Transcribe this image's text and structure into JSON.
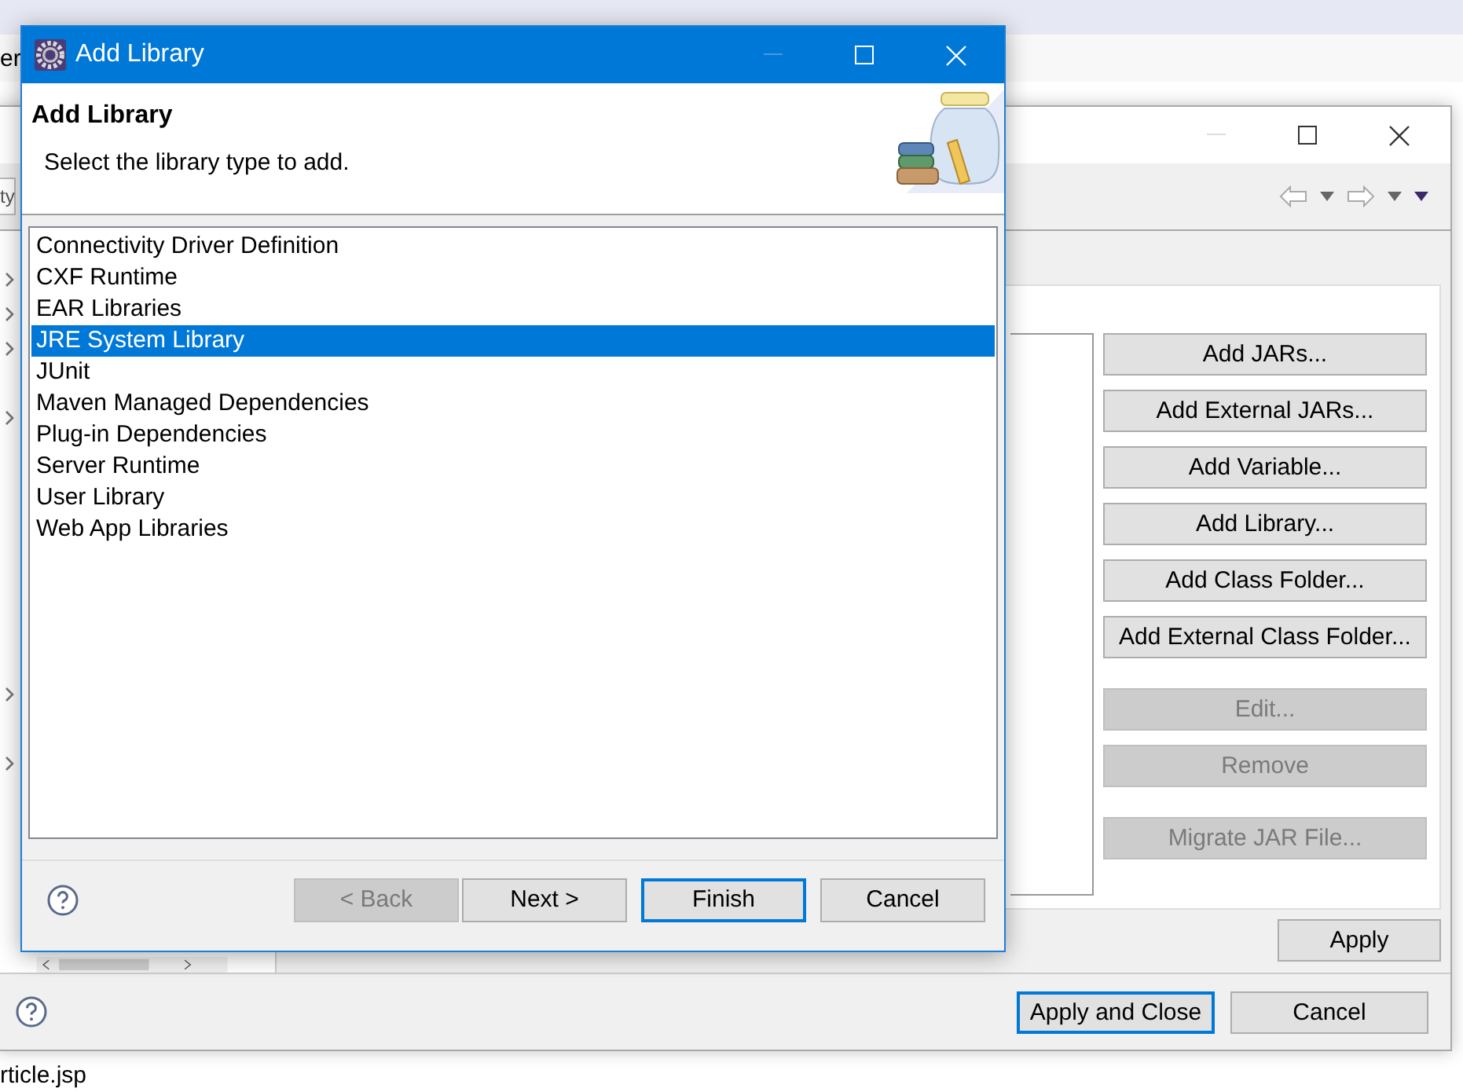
{
  "background_app": {
    "fragment_top": "er",
    "fragment_bottom": "rticle.jsp"
  },
  "back_window": {
    "filter_text": "ty",
    "tree_rows": [
      {
        "expandable": true
      },
      {
        "expandable": true
      },
      {
        "expandable": true
      },
      {
        "expandable": false
      },
      {
        "expandable": true
      },
      {
        "expandable": false
      },
      {
        "expandable": false
      },
      {
        "expandable": false
      },
      {
        "expandable": false
      },
      {
        "expandable": false
      },
      {
        "expandable": false
      },
      {
        "expandable": false
      },
      {
        "expandable": true
      },
      {
        "expandable": false
      },
      {
        "expandable": true
      }
    ],
    "button_groups": [
      [
        {
          "label": "Add JARs...",
          "disabled": false
        },
        {
          "label": "Add External JARs...",
          "disabled": false
        },
        {
          "label": "Add Variable...",
          "disabled": false
        },
        {
          "label": "Add Library...",
          "disabled": false
        },
        {
          "label": "Add Class Folder...",
          "disabled": false
        },
        {
          "label": "Add External Class Folder...",
          "disabled": false
        }
      ],
      [
        {
          "label": "Edit...",
          "disabled": true
        },
        {
          "label": "Remove",
          "disabled": true
        }
      ],
      [
        {
          "label": "Migrate JAR File...",
          "disabled": true
        }
      ]
    ],
    "apply_button": "Apply",
    "footer_buttons": [
      {
        "label": "Apply and Close",
        "default": true
      },
      {
        "label": "Cancel",
        "default": false
      }
    ]
  },
  "dialog": {
    "title": "Add Library",
    "heading": "Add Library",
    "description": "Select the library type to add.",
    "library_types": [
      {
        "label": "Connectivity Driver Definition",
        "selected": false
      },
      {
        "label": "CXF Runtime",
        "selected": false
      },
      {
        "label": "EAR Libraries",
        "selected": false
      },
      {
        "label": "JRE System Library",
        "selected": true
      },
      {
        "label": "JUnit",
        "selected": false
      },
      {
        "label": "Maven Managed Dependencies",
        "selected": false
      },
      {
        "label": "Plug-in Dependencies",
        "selected": false
      },
      {
        "label": "Server Runtime",
        "selected": false
      },
      {
        "label": "User Library",
        "selected": false
      },
      {
        "label": "Web App Libraries",
        "selected": false
      }
    ],
    "buttons": [
      {
        "label": "< Back",
        "disabled": true,
        "default": false
      },
      {
        "label": "Next >",
        "disabled": false,
        "default": false
      },
      {
        "label": "Finish",
        "disabled": false,
        "default": true
      },
      {
        "label": "Cancel",
        "disabled": false,
        "default": false
      }
    ]
  }
}
